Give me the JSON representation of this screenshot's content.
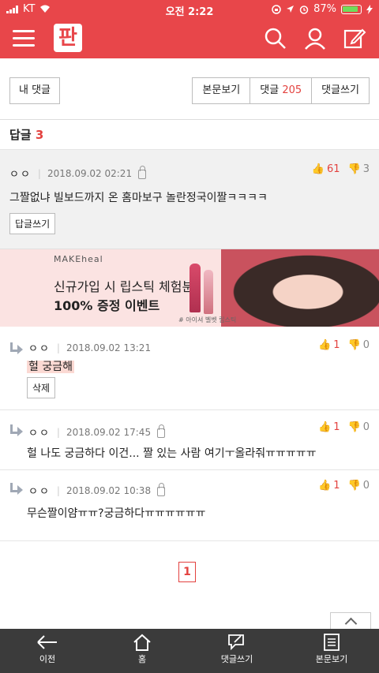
{
  "status": {
    "carrier": "KT",
    "time": "오전 2:22",
    "battery": "87%"
  },
  "top_actions": {
    "my_comments": "내 댓글",
    "view_post": "본문보기",
    "comments_label": "댓글",
    "comments_count": "205",
    "write_comment": "댓글쓰기"
  },
  "replies_header": {
    "label": "답글",
    "count": "3"
  },
  "main_comment": {
    "author": "ㅇㅇ",
    "date": "2018.09.02 02:21",
    "likes": "61",
    "dislikes": "3",
    "text": "그짤없냐 빌보드까지 온 홈마보구 놀란정국이짤ㅋㅋㅋㅋ",
    "reply_button": "답글쓰기"
  },
  "ad": {
    "brand": "MAKEheal",
    "line1": "신규가입 시 립스틱 체험분",
    "line2": "100% 증정 이벤트",
    "tag": "# 아이셔 벨벳 립스틱"
  },
  "replies": [
    {
      "author": "ㅇㅇ",
      "date": "2018.09.02 13:21",
      "likes": "1",
      "dislikes": "0",
      "text": "헐 궁금해",
      "delete": "삭제"
    },
    {
      "author": "ㅇㅇ",
      "date": "2018.09.02 17:45",
      "likes": "1",
      "dislikes": "0",
      "text": "헐 나도 궁금하다 이건... 짤 있는 사람 여기ㅜ올라줘ㅠㅠㅠㅠㅠ"
    },
    {
      "author": "ㅇㅇ",
      "date": "2018.09.02 10:38",
      "likes": "1",
      "dislikes": "0",
      "text": "무슨짤이얌ㅠㅠ?궁금하다ㅠㅠㅠㅠㅠㅠ"
    }
  ],
  "pagination": {
    "current": "1"
  },
  "bottom_nav": {
    "back": "이전",
    "home": "홈",
    "write": "댓글쓰기",
    "view": "본문보기"
  },
  "colors": {
    "brand": "#e8464a",
    "accent": "#e3423f",
    "nav_bg": "#3b3b3b"
  },
  "icons": [
    "menu-icon",
    "logo",
    "search-icon",
    "user-icon",
    "edit-icon",
    "lock-icon",
    "thumb-up-icon",
    "thumb-down-icon",
    "reply-arrow-icon",
    "back-arrow-icon",
    "home-icon",
    "write-icon",
    "document-icon"
  ]
}
